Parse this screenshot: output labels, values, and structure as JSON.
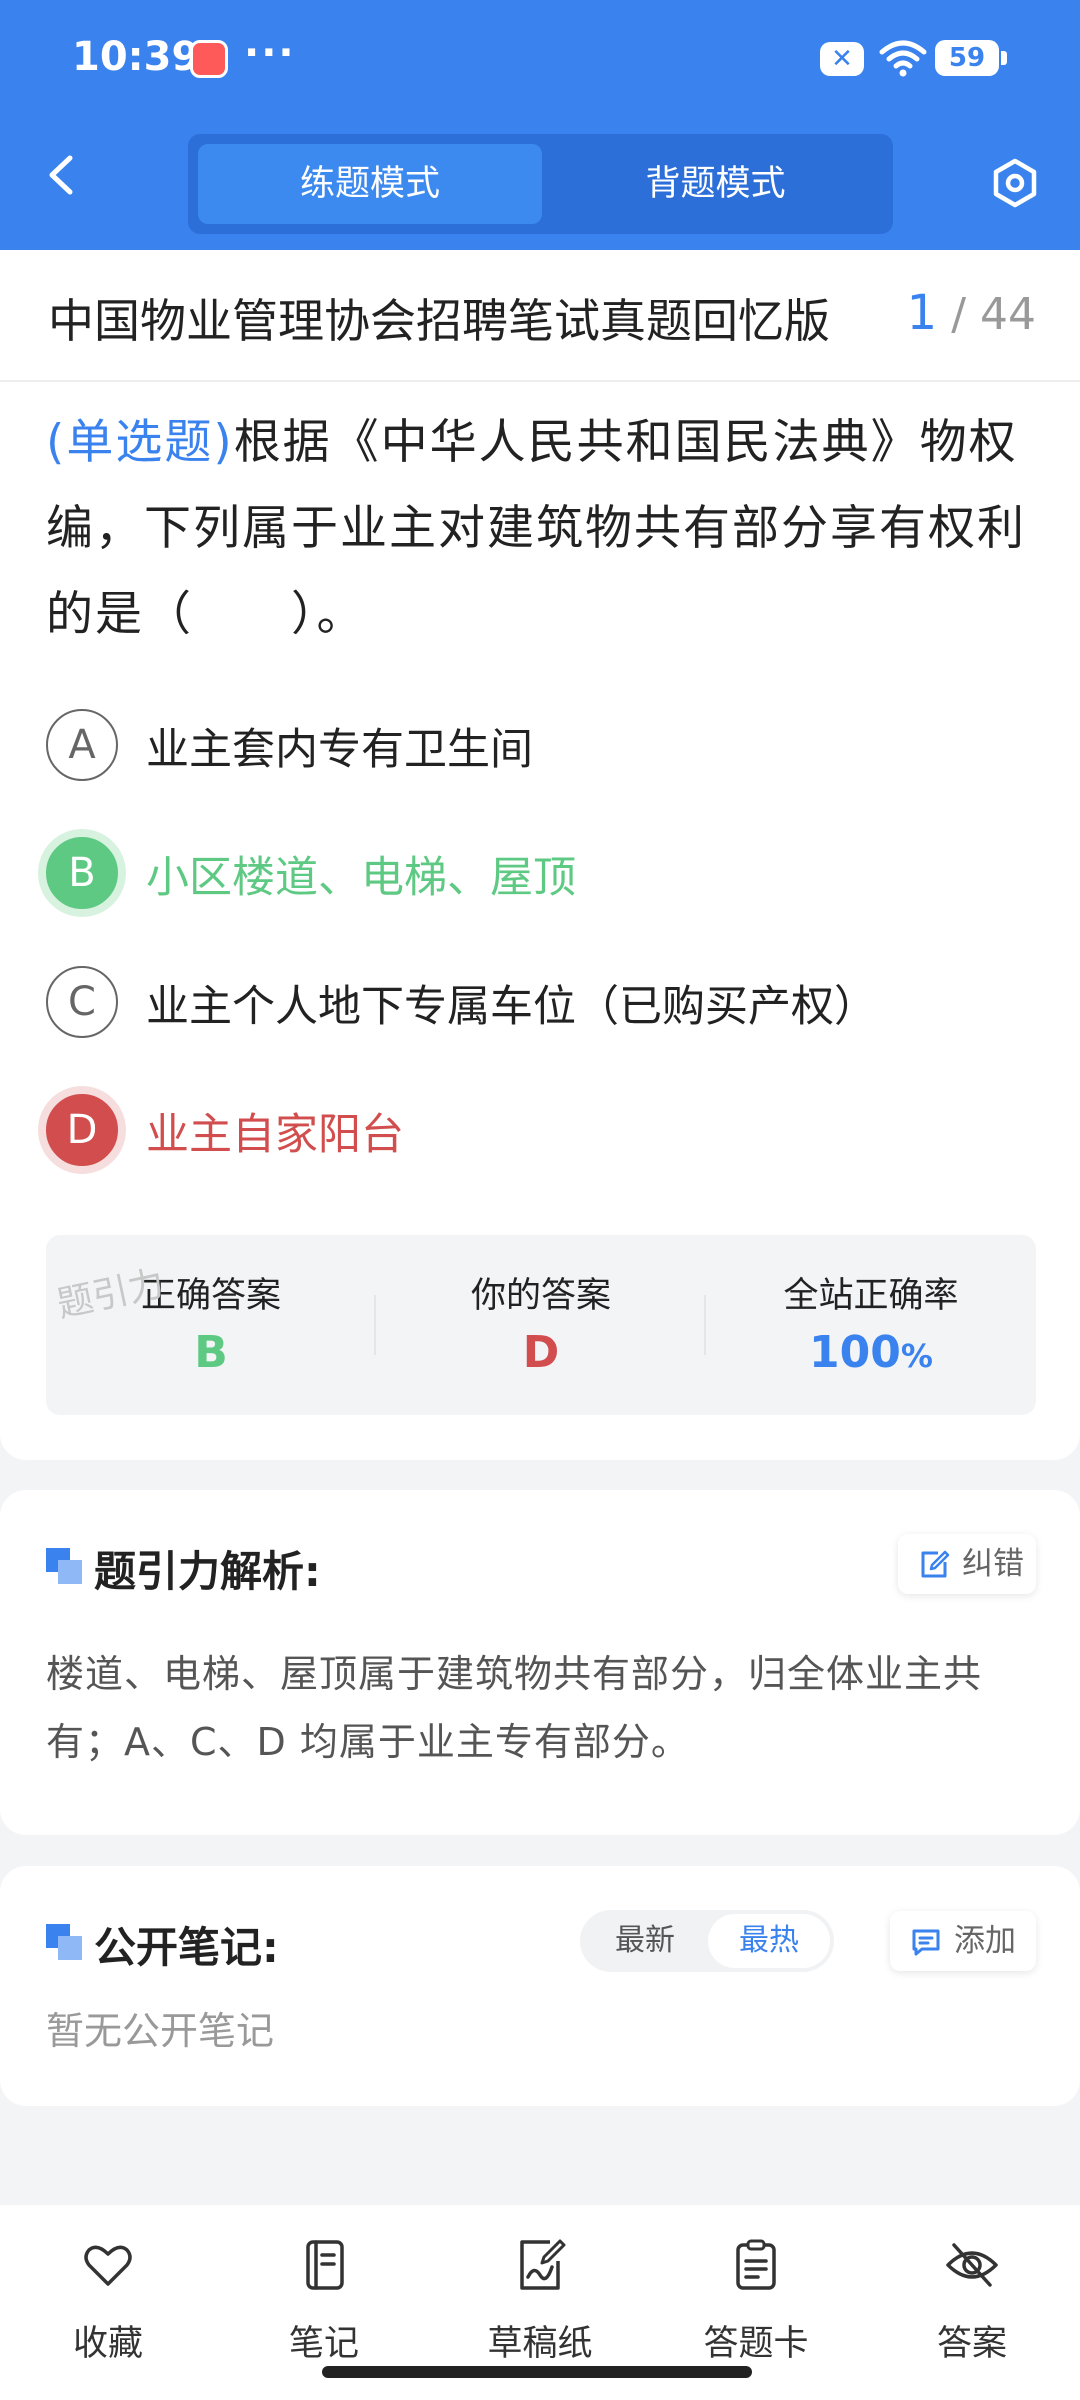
{
  "status_bar": {
    "time": "10:39",
    "more": "···",
    "battery": "59"
  },
  "header": {
    "tabs": [
      "练题模式",
      "背题模式"
    ],
    "active_tab": "练题模式"
  },
  "paper": {
    "title": "中国物业管理协会招聘笔试真题回忆版",
    "current": "1",
    "total": "/ 44"
  },
  "question": {
    "type": "(单选题)",
    "text": "根据《中华人民共和国民法典》物权编，下列属于业主对建筑物共有部分享有权利的是（　　）。",
    "options": [
      {
        "letter": "A",
        "text": "业主套内专有卫生间",
        "state": "normal"
      },
      {
        "letter": "B",
        "text": "小区楼道、电梯、屋顶",
        "state": "correct"
      },
      {
        "letter": "C",
        "text": "业主个人地下专属车位（已购买产权）",
        "state": "normal"
      },
      {
        "letter": "D",
        "text": "业主自家阳台",
        "state": "wrong"
      }
    ]
  },
  "stats": {
    "watermark": "题引力",
    "correct_label": "正确答案",
    "correct_value": "B",
    "yours_label": "你的答案",
    "yours_value": "D",
    "rate_label": "全站正确率",
    "rate_value": "100",
    "rate_unit": "%"
  },
  "analysis": {
    "title": "题引力解析:",
    "correction_button": "纠错",
    "text": "楼道、电梯、屋顶属于建筑物共有部分，归全体业主共有；A、C、D 均属于业主专有部分。"
  },
  "notes": {
    "title": "公开笔记:",
    "sort_latest": "最新",
    "sort_hot": "最热",
    "add_button": "添加",
    "empty_text": "暂无公开笔记"
  },
  "bottom_nav": [
    {
      "label": "收藏",
      "icon": "heart-icon"
    },
    {
      "label": "笔记",
      "icon": "notebook-icon"
    },
    {
      "label": "草稿纸",
      "icon": "draft-paper-icon"
    },
    {
      "label": "答题卡",
      "icon": "answer-sheet-icon"
    },
    {
      "label": "答案",
      "icon": "eye-off-icon"
    }
  ],
  "colors": {
    "brand": "#3a82ee",
    "correct": "#5ec982",
    "wrong": "#d24d4d"
  }
}
